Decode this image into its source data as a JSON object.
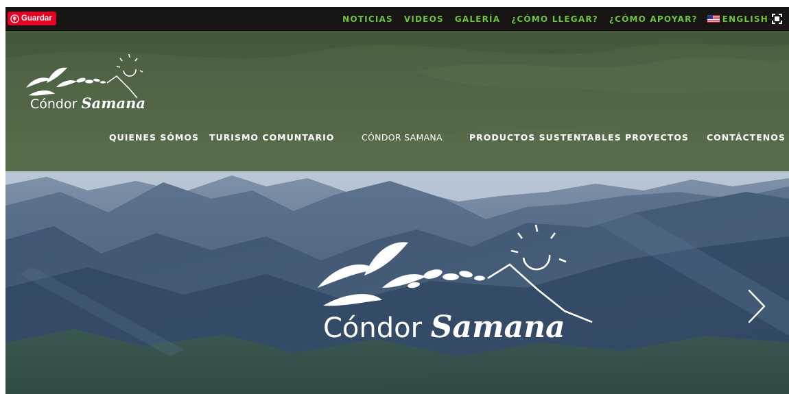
{
  "topbar": {
    "pin_button_label": "Guardar",
    "links": [
      {
        "label": "NOTICIAS"
      },
      {
        "label": "VIDEOS"
      },
      {
        "label": "GALERÍA"
      },
      {
        "label": "¿CÓMO LLEGAR?"
      },
      {
        "label": "¿CÓMO APOYAR?"
      }
    ],
    "language_label": "ENGLISH",
    "link_color": "#6fc23d",
    "pin_color": "#e60023"
  },
  "header": {
    "logo_text": "Cóndor Samana",
    "nav": [
      {
        "label": "QUIENES SÓMOS"
      },
      {
        "label": "TURISMO COMUNTARIO"
      },
      {
        "label": "CÓNDOR SAMANA"
      },
      {
        "label": "PRODUCTOS SUSTENTABLES"
      },
      {
        "label": "PROYECTOS"
      },
      {
        "label": "CONTÁCTENOS"
      }
    ],
    "background_color": "#4f6446"
  },
  "hero": {
    "logo_text": "Cóndor Samana",
    "next_icon": "chevron-right-icon"
  }
}
